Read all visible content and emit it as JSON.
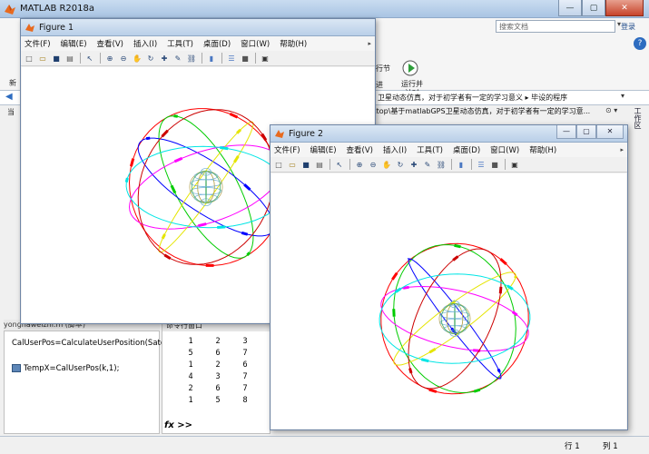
{
  "main_window": {
    "title": "MATLAB R2018a",
    "search_placeholder": "搜索文档",
    "login_label": "登录",
    "toolstrip": {
      "new_label": "新",
      "run_section_label": "行节",
      "advance_label": "进",
      "run_time_label": "运行并\n计时"
    },
    "breadcrumb": "卫星动态仿真，对于初学者有一定的学习意义  ▸  毕设的程序",
    "path_text": "ktop\\基于matlabGPS卫星动态仿真，对于初学者有一定的学习意...",
    "left_stub": "当",
    "workspace_tab": "工作区",
    "workspace_header": "yongnaweizhi.m  (脚本)",
    "editor_lines": [
      "CalUserPos=CalculateUserPosition(SatellitePosition);",
      "TempX=CalUserPos(k,1);"
    ],
    "command_window": {
      "title": "命令行窗口",
      "rows": [
        [
          "1",
          "2",
          "3"
        ],
        [
          "5",
          "6",
          "7"
        ],
        [
          "1",
          "2",
          "6"
        ],
        [
          "4",
          "3",
          "7"
        ],
        [
          "2",
          "6",
          "7"
        ],
        [
          "1",
          "5",
          "8"
        ]
      ],
      "prompt": "fx >>"
    },
    "status": {
      "row_label": "行 1",
      "col_label": "列 1"
    }
  },
  "figure_menu": [
    "文件(F)",
    "编辑(E)",
    "查看(V)",
    "插入(I)",
    "工具(T)",
    "桌面(D)",
    "窗口(W)",
    "帮助(H)"
  ],
  "figure1": {
    "title": "Figure 1"
  },
  "figure2": {
    "title": "Figure 2"
  },
  "toolbar_icons": [
    "new-figure-icon",
    "open-file-icon",
    "save-icon",
    "print-icon",
    "pointer-icon",
    "zoom-in-icon",
    "zoom-out-icon",
    "pan-icon",
    "rotate-3d-icon",
    "data-cursor-icon",
    "brush-icon",
    "link-plot-icon",
    "colorbar-icon",
    "legend-icon",
    "hide-plot-tools-icon",
    "show-plot-tools-icon"
  ],
  "colors": {
    "orbit_colors": [
      "#ff0000",
      "#00cc00",
      "#0000ff",
      "#ff00ff",
      "#00e5e5",
      "#e5e500",
      "#cc0000"
    ],
    "title_gradient": "#b9cfe8"
  }
}
